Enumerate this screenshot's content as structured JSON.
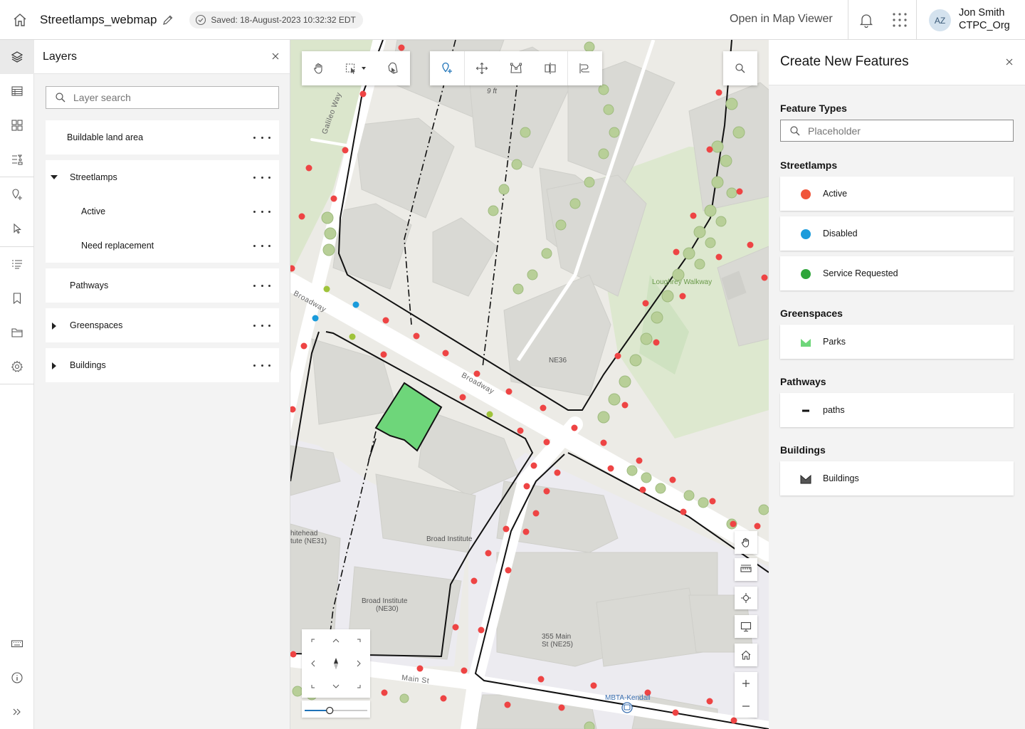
{
  "header": {
    "title": "Streetlamps_webmap",
    "save_status": "Saved: 18-August-2023 10:32:32 EDT",
    "open_in_map_viewer": "Open in Map Viewer",
    "user": {
      "initials": "AZ",
      "name": "Jon Smith",
      "org": "CTPC_Org"
    }
  },
  "action_bar": {
    "items": [
      "layers-icon",
      "table-icon",
      "basemap-icon",
      "legend-icon",
      "create-features-icon",
      "select-icon",
      "list-icon",
      "bookmark-icon",
      "folder-icon",
      "settings-icon"
    ],
    "bottom": [
      "keyboard-icon",
      "info-icon",
      "expand-icon"
    ]
  },
  "layers_panel": {
    "title": "Layers",
    "search_placeholder": "Layer search",
    "layers": {
      "buildable": "Buildable land area",
      "streetlamps": "Streetlamps",
      "active": "Active",
      "need_replacement": "Need replacement",
      "pathways": "Pathways",
      "greenspaces": "Greenspaces",
      "buildings": "Buildings"
    }
  },
  "map": {
    "scale_label": "9 ft",
    "labels": {
      "galileo_way": "Galileo Way",
      "broadway_1": "Broadway",
      "broadway_2": "Broadway",
      "loughrey": "Loughrey Walkway",
      "ne36": "NE36",
      "whitehead_1": "hitehead",
      "whitehead_2": "tute (NE31)",
      "broad_institute": "Broad Institute",
      "broad_ne30_1": "Broad Institute",
      "broad_ne30_2": "(NE30)",
      "main_355_1": "355 Main",
      "main_355_2": "St (NE25)",
      "main_st": "Main St",
      "mbta": "MBTA-Kendall"
    },
    "zoom_level_fraction": 0.4
  },
  "create_panel": {
    "title": "Create New Features",
    "feature_types_heading": "Feature Types",
    "search_placeholder": "Placeholder",
    "groups": {
      "streetlamps": "Streetlamps",
      "greenspaces": "Greenspaces",
      "pathways": "Pathways",
      "buildings": "Buildings"
    },
    "types": {
      "active": "Active",
      "disabled": "Disabled",
      "service_requested": "Service Requested",
      "parks": "Parks",
      "paths": "paths",
      "buildings": "Buildings"
    }
  },
  "colors": {
    "active": "#ee4444",
    "disabled": "#1a9bdb",
    "service_requested": "#2ea53a",
    "park_fill": "#6ed67a",
    "lamp_green": "#9fc33a"
  }
}
